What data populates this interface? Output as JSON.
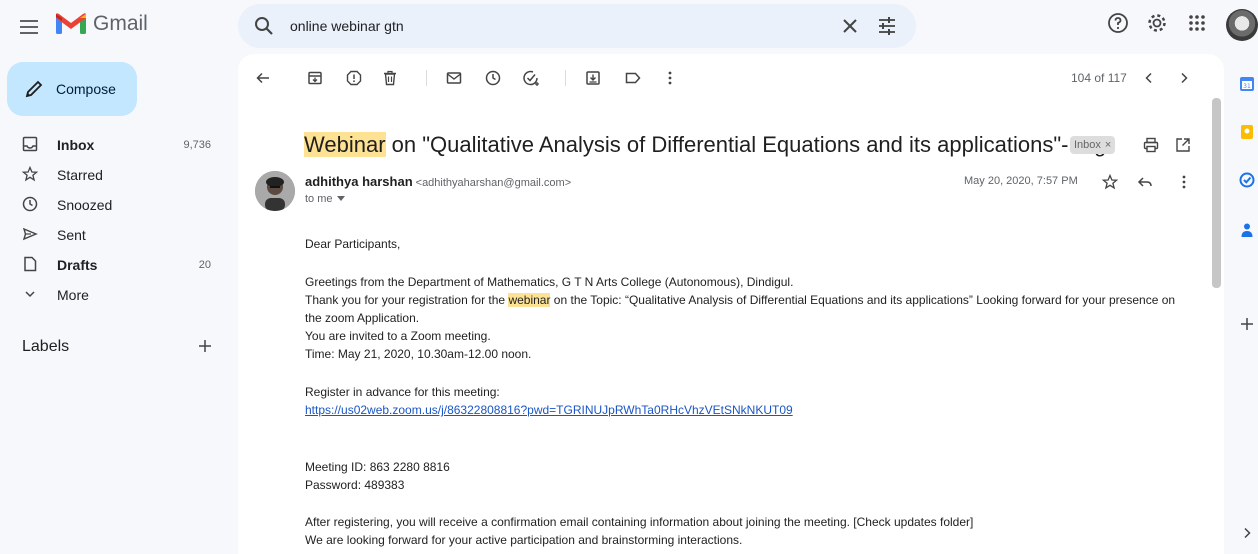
{
  "app": {
    "name": "Gmail"
  },
  "search": {
    "query": "online webinar gtn"
  },
  "colors": {
    "compose_bg": "#c2e7ff",
    "highlight": "#fde293",
    "link": "#1a55c5",
    "page_bg": "#f6f8fc"
  },
  "sidebar": {
    "compose_label": "Compose",
    "items": [
      {
        "label": "Inbox",
        "count": "9,736",
        "icon": "inbox-icon"
      },
      {
        "label": "Starred",
        "count": "",
        "icon": "star-icon"
      },
      {
        "label": "Snoozed",
        "count": "",
        "icon": "clock-icon"
      },
      {
        "label": "Sent",
        "count": "",
        "icon": "send-icon"
      },
      {
        "label": "Drafts",
        "count": "20",
        "icon": "draft-icon"
      },
      {
        "label": "More",
        "count": "",
        "icon": "chevron-down-icon"
      }
    ],
    "labels_title": "Labels"
  },
  "toolbar": {
    "pager": "104 of 117"
  },
  "email": {
    "subject_highlight": "Webinar",
    "subject_rest": " on \"Qualitative Analysis of Differential Equations and its applications\"- reg",
    "chip_label": "Inbox",
    "chip_close": "×",
    "sender_name": "adhithya harshan",
    "sender_email": "<adhithyaharshan@gmail.com>",
    "to": "to me",
    "date": "May 20, 2020, 7:57 PM",
    "body": {
      "greeting": "Dear Participants,",
      "line1": "Greetings from the Department of Mathematics, G T N Arts College (Autonomous), Dindigul.",
      "line2_pre": "Thank you for your registration for the ",
      "line2_hl": "webinar",
      "line2_post": " on the Topic: “Qualitative Analysis of Differential Equations and its applications” Looking forward for your presence on",
      "line3": "the zoom Application.",
      "line4": "You are invited to a Zoom meeting.",
      "line5": "Time: May 21, 2020, 10.30am-12.00 noon.",
      "register": "Register in advance for this meeting:",
      "link": "https://us02web.zoom.us/j/86322808816?pwd=TGRINUJpRWhTa0RHcVhzVEtSNkNKUT09",
      "meeting_id": "Meeting ID: 863 2280 8816",
      "password": "Password: 489383",
      "after": "After registering, you will receive a confirmation email containing information about joining the meeting. [Check updates folder]",
      "closing": "We are looking forward for your active participation and brainstorming interactions."
    }
  }
}
